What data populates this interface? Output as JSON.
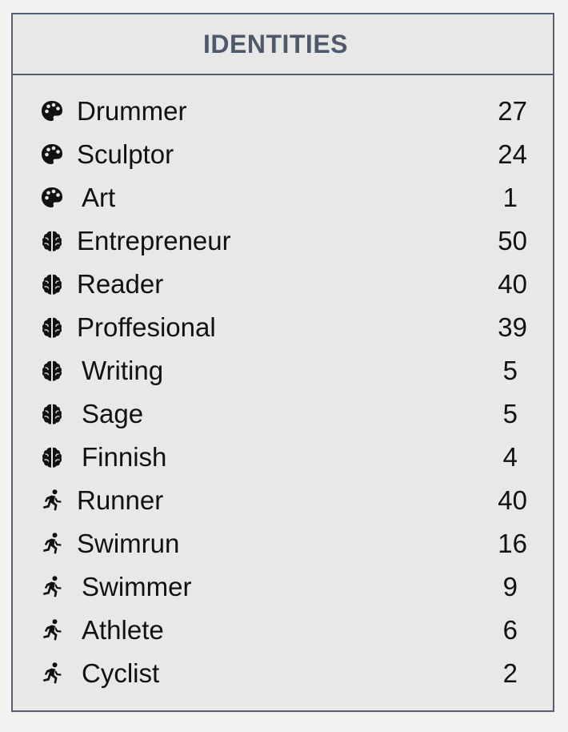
{
  "panel": {
    "title": "IDENTITIES"
  },
  "items": [
    {
      "icon": "palette-icon",
      "label": "Drummer",
      "count": "27"
    },
    {
      "icon": "palette-icon",
      "label": "Sculptor",
      "count": "24"
    },
    {
      "icon": "palette-icon",
      "label": "Art",
      "count": "1"
    },
    {
      "icon": "brain-icon",
      "label": "Entrepreneur",
      "count": "50"
    },
    {
      "icon": "brain-icon",
      "label": "Reader",
      "count": "40"
    },
    {
      "icon": "brain-icon",
      "label": "Proffesional",
      "count": "39"
    },
    {
      "icon": "brain-icon",
      "label": "Writing",
      "count": "5"
    },
    {
      "icon": "brain-icon",
      "label": "Sage",
      "count": "5"
    },
    {
      "icon": "brain-icon",
      "label": "Finnish",
      "count": "4"
    },
    {
      "icon": "running-icon",
      "label": "Runner",
      "count": "40"
    },
    {
      "icon": "running-icon",
      "label": "Swimrun",
      "count": "16"
    },
    {
      "icon": "running-icon",
      "label": "Swimmer",
      "count": "9"
    },
    {
      "icon": "running-icon",
      "label": "Athlete",
      "count": "6"
    },
    {
      "icon": "running-icon",
      "label": "Cyclist",
      "count": "2"
    }
  ],
  "colors": {
    "header_text": "#4e5a6b",
    "border": "#56606e",
    "panel_bg": "#e8e8e8",
    "page_bg": "#f2f2f2",
    "text": "#111111"
  }
}
